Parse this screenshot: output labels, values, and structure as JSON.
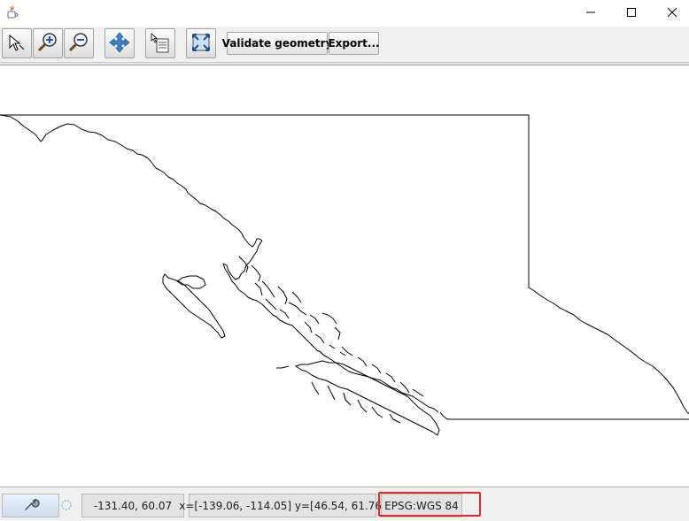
{
  "window": {
    "app_icon": "java-cup-icon",
    "controls": [
      "minimize-icon",
      "maximize-icon",
      "close-icon"
    ]
  },
  "toolbar": {
    "tools": [
      "pointer-icon",
      "zoom-in-icon",
      "zoom-out-icon",
      "pan-icon",
      "info-icon",
      "reset-extent-icon"
    ],
    "validate_label": "Validate geometry",
    "export_label": "Export..."
  },
  "map": {
    "feature": "british-columbia-outline",
    "stroke_color": "#000000"
  },
  "status": {
    "settings_icon": "wrench-icon",
    "busy_icon": "spinner-icon",
    "cursor_position": "-131.40, 60.07",
    "extent": "x=[-139.06, -114.05] y=[46.54, 61.76]",
    "crs": "EPSG:WGS 84",
    "highlight_color": "#e8292b"
  }
}
